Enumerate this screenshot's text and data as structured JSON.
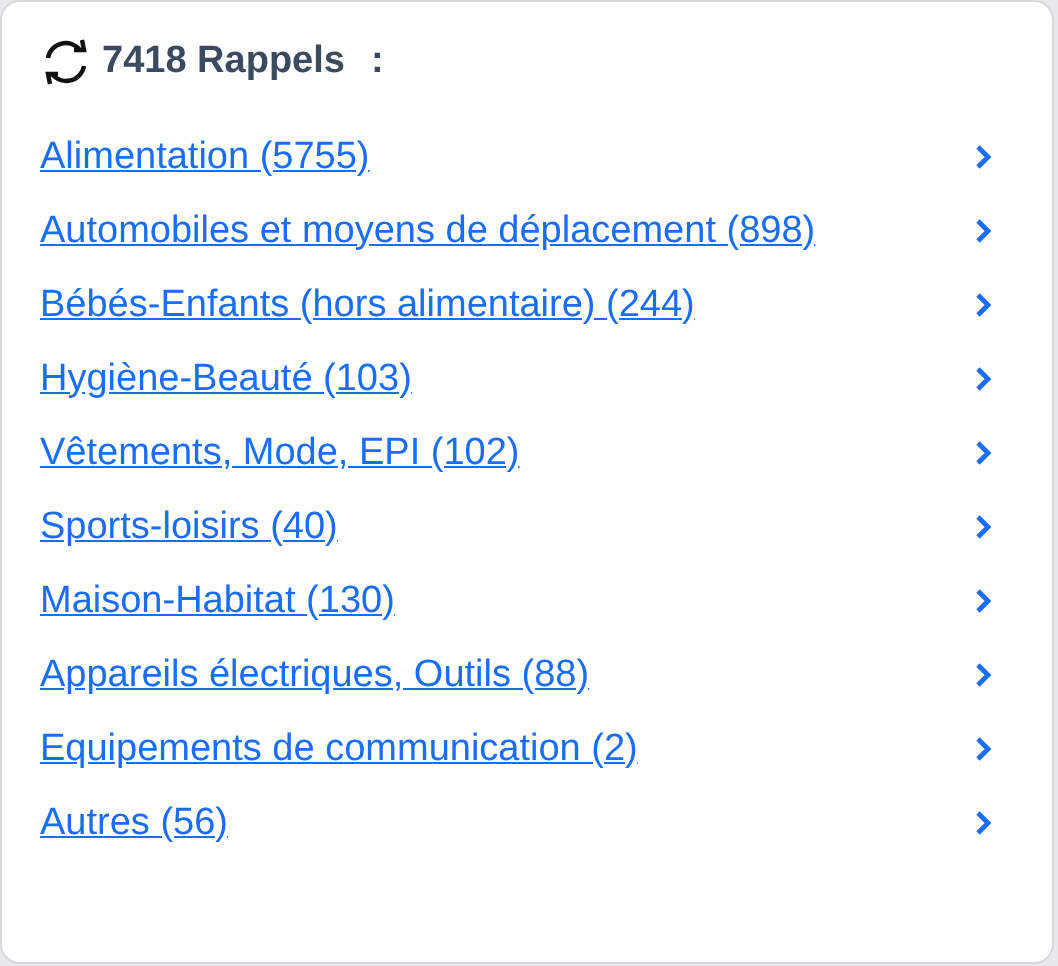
{
  "header": {
    "title": "7418 Rappels",
    "separator": ":"
  },
  "categories": [
    {
      "label": "Alimentation (5755)"
    },
    {
      "label": "Automobiles et moyens de déplacement (898)"
    },
    {
      "label": "Bébés-Enfants (hors alimentaire) (244)"
    },
    {
      "label": "Hygiène-Beauté (103)"
    },
    {
      "label": "Vêtements, Mode, EPI (102)"
    },
    {
      "label": "Sports-loisirs (40)"
    },
    {
      "label": "Maison-Habitat (130)"
    },
    {
      "label": "Appareils électriques, Outils (88)"
    },
    {
      "label": "Equipements de communication (2)"
    },
    {
      "label": "Autres (56)"
    }
  ]
}
